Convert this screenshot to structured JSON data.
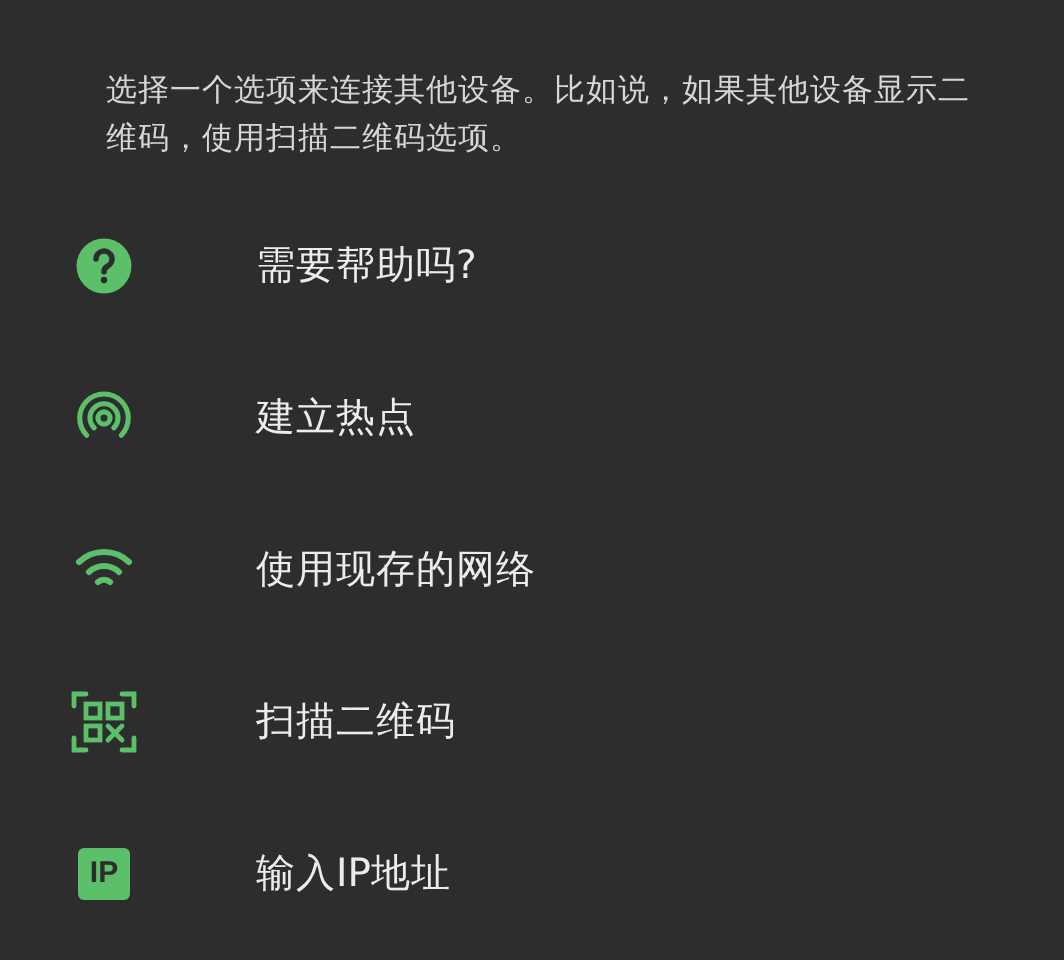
{
  "description": "选择一个选项来连接其他设备。比如说，如果其他设备显示二维码，使用扫描二维码选项。",
  "options": [
    {
      "kind": "help",
      "label": "需要帮助吗?"
    },
    {
      "kind": "hotspot",
      "label": "建立热点"
    },
    {
      "kind": "wifi",
      "label": "使用现存的网络"
    },
    {
      "kind": "qr",
      "label": "扫描二维码"
    },
    {
      "kind": "ip",
      "label": "输入IP地址",
      "icon_text": "IP"
    }
  ]
}
